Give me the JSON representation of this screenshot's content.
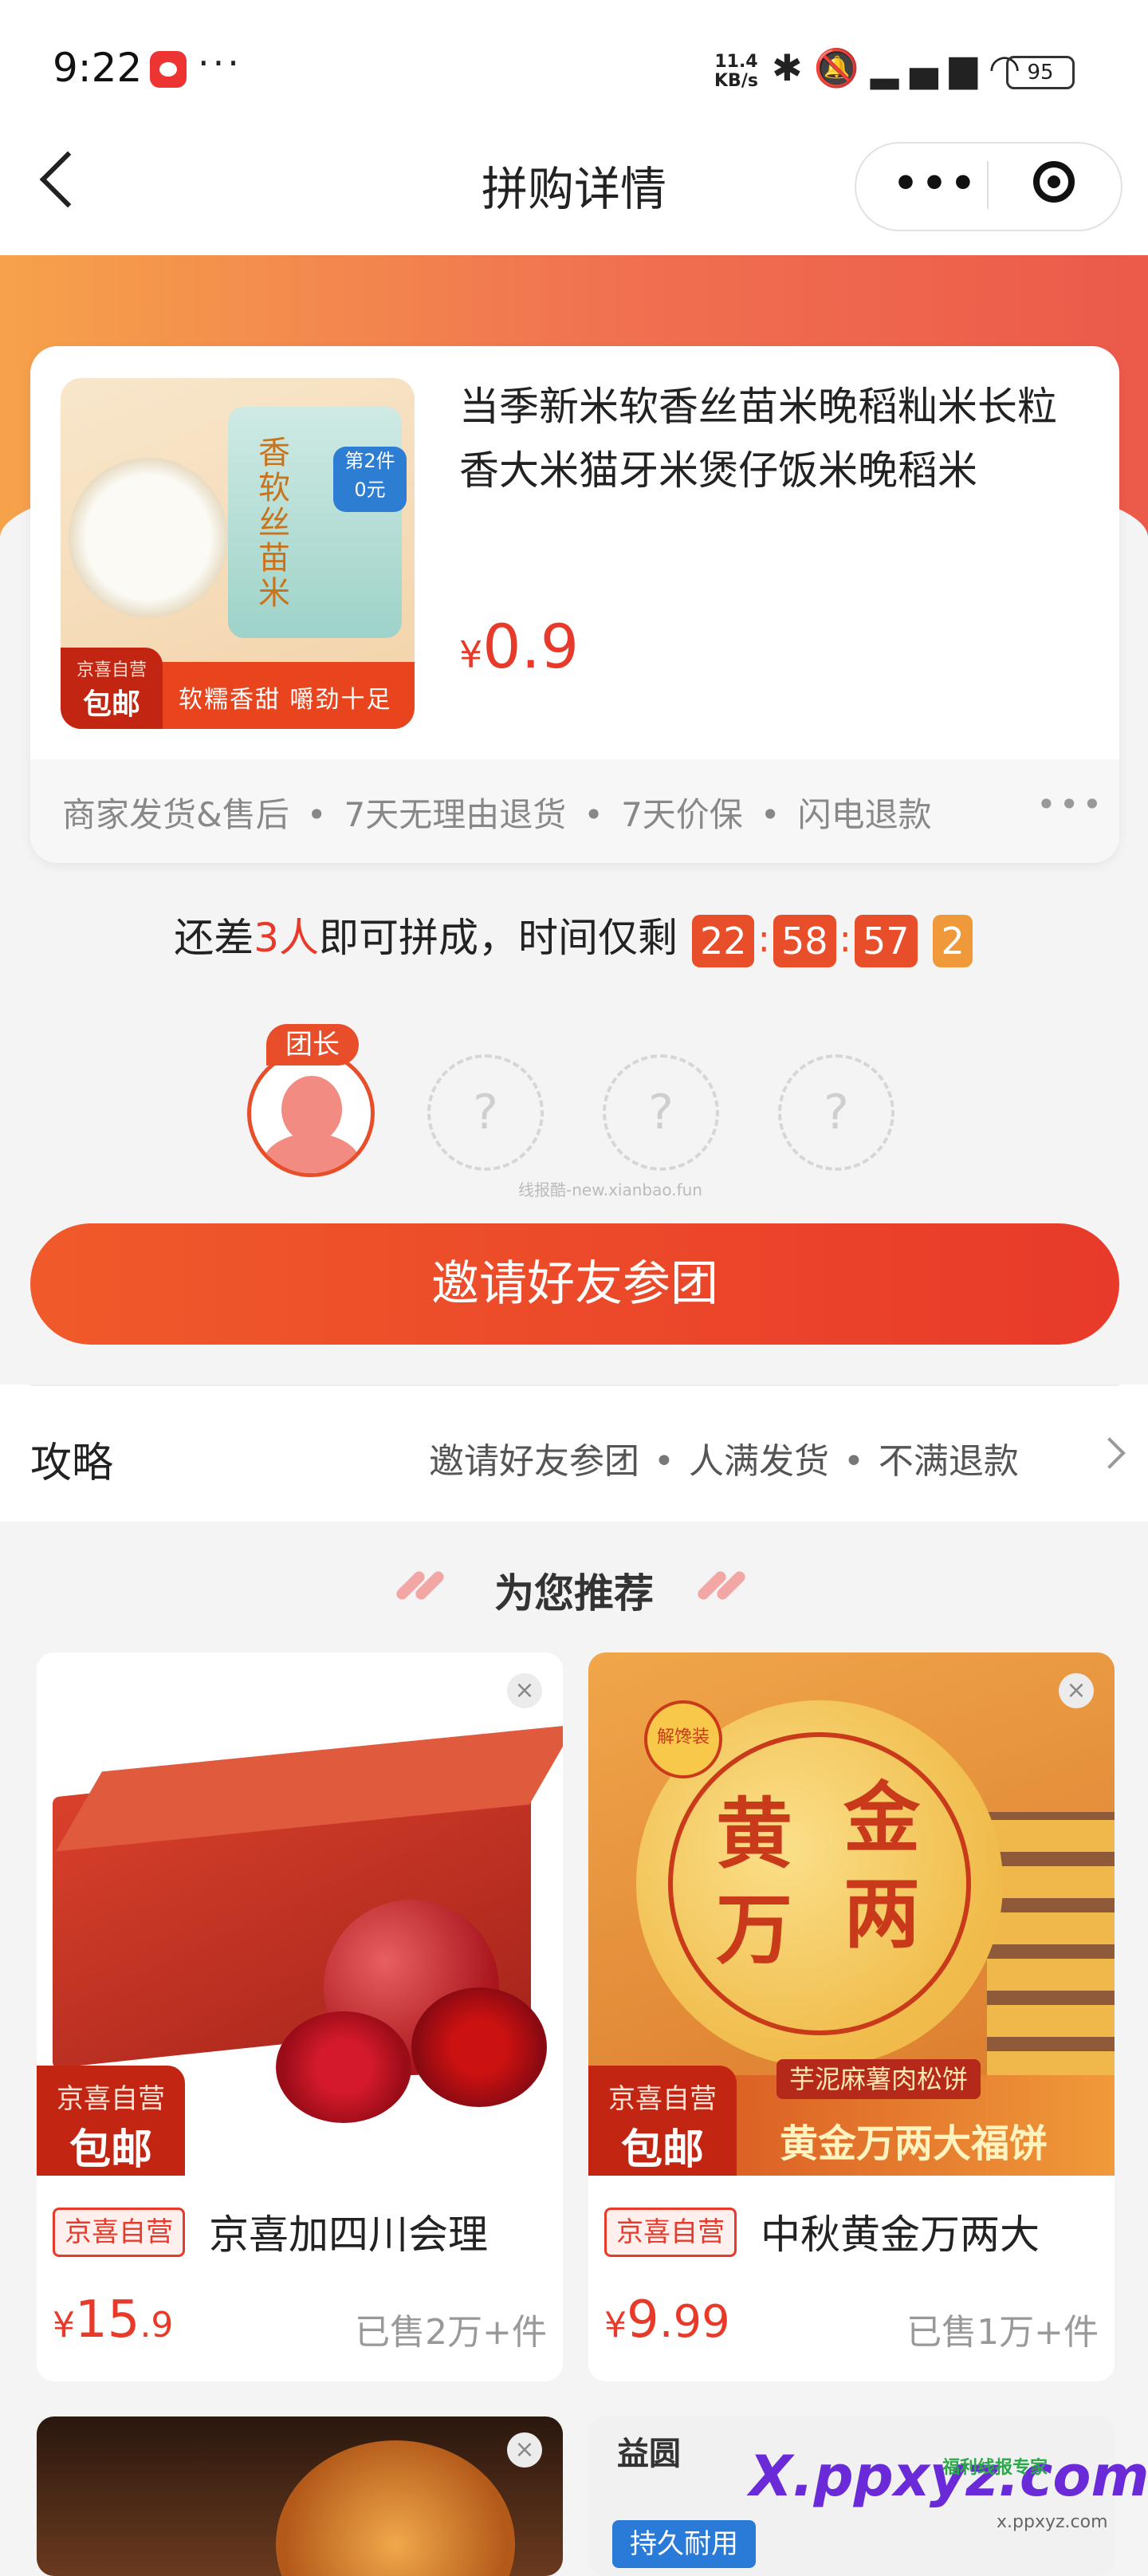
{
  "status_bar": {
    "time": "9:22",
    "dots": "···",
    "net_speed_value": "11.4",
    "net_speed_unit": "KB/s",
    "battery": "95",
    "icons": [
      "bluetooth-icon",
      "mute-icon",
      "signal-icon",
      "wifi-icon"
    ]
  },
  "nav": {
    "title": "拼购详情",
    "more": "•••"
  },
  "product": {
    "title": "当季新米软香丝苗米晚稻籼米长粒香大米猫牙米煲仔饭米晚稻米",
    "currency": "¥",
    "price": "0.9",
    "image": {
      "brand_small": "京喜自营",
      "tag": "包邮",
      "slogan": "软糯香甜 嚼劲十足",
      "bag_text": "香软丝苗米",
      "badge_line1": "第2件",
      "badge_line2": "0元"
    },
    "services": [
      "商家发货&售后",
      "7天无理由退货",
      "7天价保",
      "闪电退款"
    ],
    "services_more": "•••"
  },
  "countdown": {
    "prefix": "还差",
    "count": "3人",
    "suffix": "即可拼成，时间仅剩",
    "hours": "22",
    "minutes": "58",
    "seconds": "57",
    "tenths": "2"
  },
  "group": {
    "leader_label": "团长",
    "empty_slot": "?",
    "watermark": "线报酷-new.xianbao.fun"
  },
  "invite_button": "邀请好友参团",
  "strategy": {
    "title": "攻略",
    "items": [
      "邀请好友参团",
      "人满发货",
      "不满退款"
    ]
  },
  "recommend": {
    "title": "为您推荐",
    "items": [
      {
        "badge": "京喜自营",
        "name": "京喜加四川会理",
        "currency": "¥",
        "price_int": "15",
        "price_dec": ".9",
        "sold": "已售2万+件",
        "img_brand": "京喜自营",
        "img_tag": "包邮"
      },
      {
        "badge": "京喜自营",
        "name": "中秋黄金万两大",
        "currency": "¥",
        "price_int": "9",
        "price_dec": ".99",
        "sold": "已售1万+件",
        "img_brand": "京喜自营",
        "img_tag": "包邮",
        "img_sub": "芋泥麻薯肉松饼",
        "img_title": "黄金万两大福饼",
        "img_badge": "解馋装",
        "cake_chars": [
          "黄",
          "金",
          "万",
          "两"
        ]
      }
    ],
    "close_glyph": "×"
  },
  "bottom_cards": {
    "card2_logo": "益圆",
    "card2_tag": "持久耐用"
  },
  "overlay_watermark": {
    "text": "X.ppxyz.com",
    "sub": "福利线报专家",
    "url": "x.ppxyz.com"
  }
}
